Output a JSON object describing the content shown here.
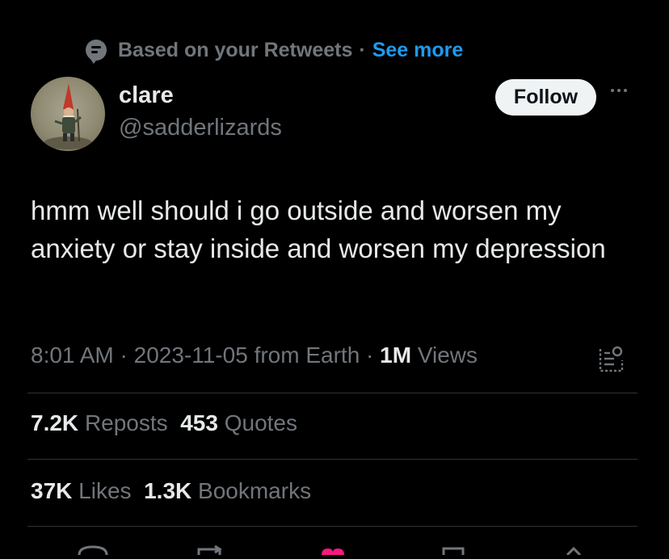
{
  "context": {
    "text": "Based on your Retweets",
    "separator": "·",
    "link": "See more",
    "icon": "speech-bubble-icon"
  },
  "author": {
    "name": "clare",
    "handle": "@sadderlizards",
    "avatar": "gnome-figure"
  },
  "follow_label": "Follow",
  "more_icon": "more-dots-icon",
  "tweet": {
    "text": "hmm well should i go outside and worsen my anxiety or stay inside and worsen my depression"
  },
  "meta": {
    "time": "8:01 AM",
    "sep1": "·",
    "date": "2023-11-05",
    "source": "from Earth",
    "sep2": "·",
    "views_count": "1M",
    "views_label": "Views",
    "analytics_icon": "analytics-icon"
  },
  "stats_row1": {
    "reposts_count": "7.2K",
    "reposts_label": "Reposts",
    "quotes_count": "453",
    "quotes_label": "Quotes"
  },
  "stats_row2": {
    "likes_count": "37K",
    "likes_label": "Likes",
    "bookmarks_count": "1.3K",
    "bookmarks_label": "Bookmarks"
  },
  "colors": {
    "background": "#000000",
    "text": "#e7e9ea",
    "secondary": "#71767b",
    "link": "#1d9bf0",
    "like_accent": "#f91880"
  }
}
